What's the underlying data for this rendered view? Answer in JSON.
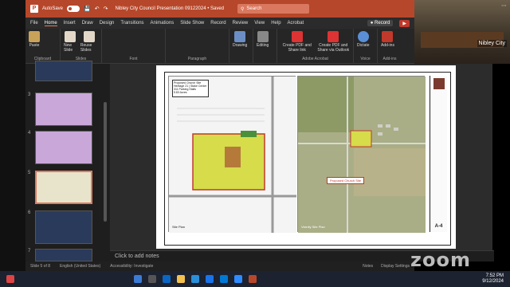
{
  "window": {
    "autosave_label": "AutoSave",
    "autosave_state": "On",
    "doc_title": "Nibley City Council Presentation 09122024 • Saved",
    "search_placeholder": "Search"
  },
  "ribbon_tabs": [
    "File",
    "Home",
    "Insert",
    "Draw",
    "Design",
    "Transitions",
    "Animations",
    "Slide Show",
    "Record",
    "Review",
    "View",
    "Help",
    "Acrobat"
  ],
  "active_tab": "Home",
  "record_label": "Record",
  "present_label": "",
  "ribbon": {
    "clipboard": {
      "paste": "Paste",
      "label": "Clipboard"
    },
    "slides": {
      "new_slide": "New Slide",
      "reuse": "Reuse Slides",
      "label": "Slides"
    },
    "font_label": "Font",
    "paragraph_label": "Paragraph",
    "drawing": {
      "label": "Drawing"
    },
    "editing": {
      "label": "Editing"
    },
    "acrobat": {
      "create_pdf_share": "Create PDF and Share link",
      "create_pdf_outlook": "Create PDF and Share via Outlook",
      "label": "Adobe Acrobat"
    },
    "dictate": {
      "label": "Dictate",
      "group": "Voice"
    },
    "addins": {
      "label": "Add-ins",
      "group": "Add-ins"
    }
  },
  "zoom_participant": {
    "name": "Nibley City"
  },
  "thumbnails": [
    {
      "num": "3"
    },
    {
      "num": "4"
    },
    {
      "num": "5",
      "selected": true
    },
    {
      "num": "6"
    },
    {
      "num": "7"
    }
  ],
  "slide": {
    "info_lines": [
      "Proposed Church Site",
      "Heritage 21 | Stake Center",
      "311 Parking Stalls",
      "5.83 Acres"
    ],
    "church_label": "Proposed Church Site",
    "left_caption": "Site Plan",
    "right_caption": "Vicinity Site Plan",
    "sheet_number": "A-4"
  },
  "notes_placeholder": "Click to add notes",
  "status": {
    "slide_count": "Slide 5 of 8",
    "language": "English (United States)",
    "accessibility": "Accessibility: Investigate",
    "notes": "Notes",
    "display": "Display Settings"
  },
  "zoom_logo": "zoom",
  "taskbar": {
    "time": "7:52 PM",
    "date": "9/12/2024"
  },
  "colors": {
    "accent": "#b7472a",
    "ribbon_bg": "#262626"
  }
}
